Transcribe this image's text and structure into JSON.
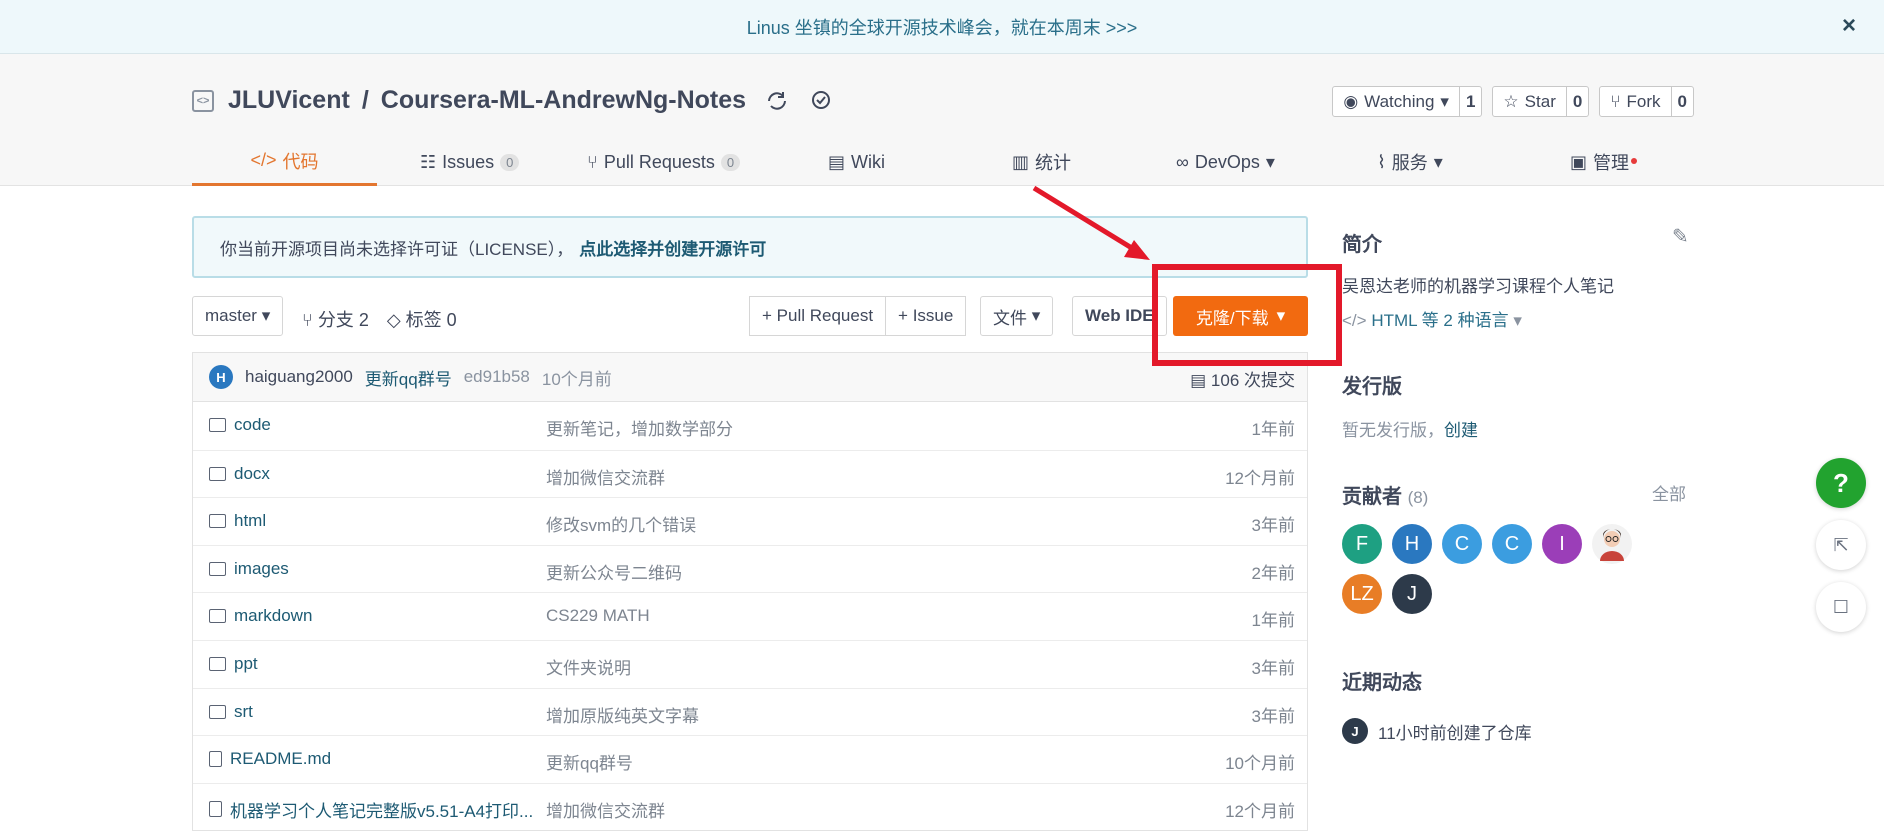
{
  "announcement": {
    "text": "Linus 坐镇的全球开源技术峰会，就在本周末 >>>",
    "close": "×"
  },
  "repo": {
    "owner": "JLUVicent",
    "separator": "/",
    "name": "Coursera-ML-AndrewNg-Notes",
    "actions": [
      {
        "label": "Watching",
        "count": "1"
      },
      {
        "label": "Star",
        "count": "0"
      },
      {
        "label": "Fork",
        "count": "0"
      }
    ]
  },
  "tabs": {
    "code": "代码",
    "issues": "Issues",
    "issues_count": "0",
    "pulls": "Pull Requests",
    "pulls_count": "0",
    "wiki": "Wiki",
    "stats": "统计",
    "devops": "DevOps",
    "services": "服务",
    "manage": "管理"
  },
  "license": {
    "text": "你当前开源项目尚未选择许可证（LICENSE），",
    "link": "点此选择并创建开源许可"
  },
  "toolbar": {
    "branch": "master",
    "branches": "分支 2",
    "tags": "标签 0",
    "pull_request": "+ Pull Request",
    "issue": "+ Issue",
    "files": "文件",
    "web_ide": "Web IDE",
    "clone": "克隆/下载"
  },
  "commit": {
    "avatar": "H",
    "author": "haiguang2000",
    "message": "更新qq群号",
    "hash": "ed91b58",
    "time": "10个月前",
    "count": "106 次提交"
  },
  "files": [
    {
      "name": "code",
      "type": "folder",
      "message": "更新笔记，增加数学部分",
      "time": "1年前"
    },
    {
      "name": "docx",
      "type": "folder",
      "message": "增加微信交流群",
      "time": "12个月前"
    },
    {
      "name": "html",
      "type": "folder",
      "message": "修改svm的几个错误",
      "time": "3年前"
    },
    {
      "name": "images",
      "type": "folder",
      "message": "更新公众号二维码",
      "time": "2年前"
    },
    {
      "name": "markdown",
      "type": "folder",
      "message": "CS229 MATH",
      "time": "1年前"
    },
    {
      "name": "ppt",
      "type": "folder",
      "message": "文件夹说明",
      "time": "3年前"
    },
    {
      "name": "srt",
      "type": "folder",
      "message": "增加原版纯英文字幕",
      "time": "3年前"
    },
    {
      "name": "README.md",
      "type": "file",
      "message": "更新qq群号",
      "time": "10个月前"
    },
    {
      "name": "机器学习个人笔记完整版v5.51-A4打印...",
      "type": "file",
      "message": "增加微信交流群",
      "time": "12个月前"
    }
  ],
  "sidebar": {
    "intro_title": "简介",
    "intro_text": "吴恩达老师的机器学习课程个人笔记",
    "language": "HTML 等 2 种语言",
    "releases_title": "发行版",
    "releases_text": "暂无发行版，",
    "releases_link": "创建",
    "contributors_title": "贡献者",
    "contributors_count": "(8)",
    "contributors_all": "全部",
    "contributors": [
      {
        "initial": "F",
        "color": "#1ea082"
      },
      {
        "initial": "H",
        "color": "#2a78c0"
      },
      {
        "initial": "C",
        "color": "#3b9de0"
      },
      {
        "initial": "C",
        "color": "#3b9de0"
      },
      {
        "initial": "I",
        "color": "#9b3eb8"
      },
      {
        "initial": "",
        "color": "#f2f2f2"
      },
      {
        "initial": "LZ",
        "color": "#e87d26"
      },
      {
        "initial": "J",
        "color": "#2d3a4a"
      }
    ],
    "activity_title": "近期动态",
    "activity_avatar": "J",
    "activity_text": "11小时前创建了仓库"
  }
}
